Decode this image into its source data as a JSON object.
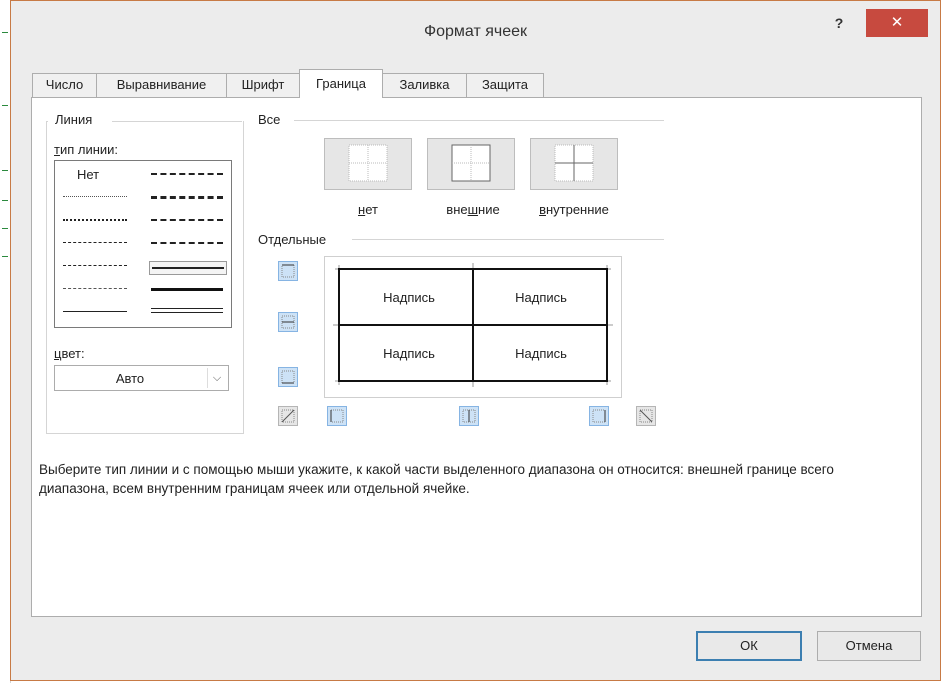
{
  "window": {
    "title": "Формат ячеек",
    "help_label": "?",
    "close_label": "✕"
  },
  "tabs": [
    {
      "label": "Число"
    },
    {
      "label": "Выравнивание"
    },
    {
      "label": "Шрифт"
    },
    {
      "label": "Граница",
      "active": true
    },
    {
      "label": "Заливка"
    },
    {
      "label": "Защита"
    }
  ],
  "line_group": {
    "title": "Линия",
    "type_label": "тип линии:",
    "none_label": "Нет",
    "color_label": "цвет:",
    "color_value": "Авто"
  },
  "all_group": {
    "title": "Все",
    "presets": [
      {
        "label": "нет"
      },
      {
        "label": "внешние"
      },
      {
        "label": "внутренние"
      }
    ]
  },
  "separate_group": {
    "title": "Отдельные",
    "cells": [
      "Надпись",
      "Надпись",
      "Надпись",
      "Надпись"
    ]
  },
  "description": "Выберите тип линии и с помощью мыши укажите, к какой части выделенного диапазона он относится: внешней границе всего диапазона, всем внутренним границам ячеек или отдельной ячейке.",
  "buttons": {
    "ok": "ОК",
    "cancel": "Отмена"
  },
  "colors": {
    "close_button": "#c74a3f",
    "border_button": "#cde2f6"
  }
}
